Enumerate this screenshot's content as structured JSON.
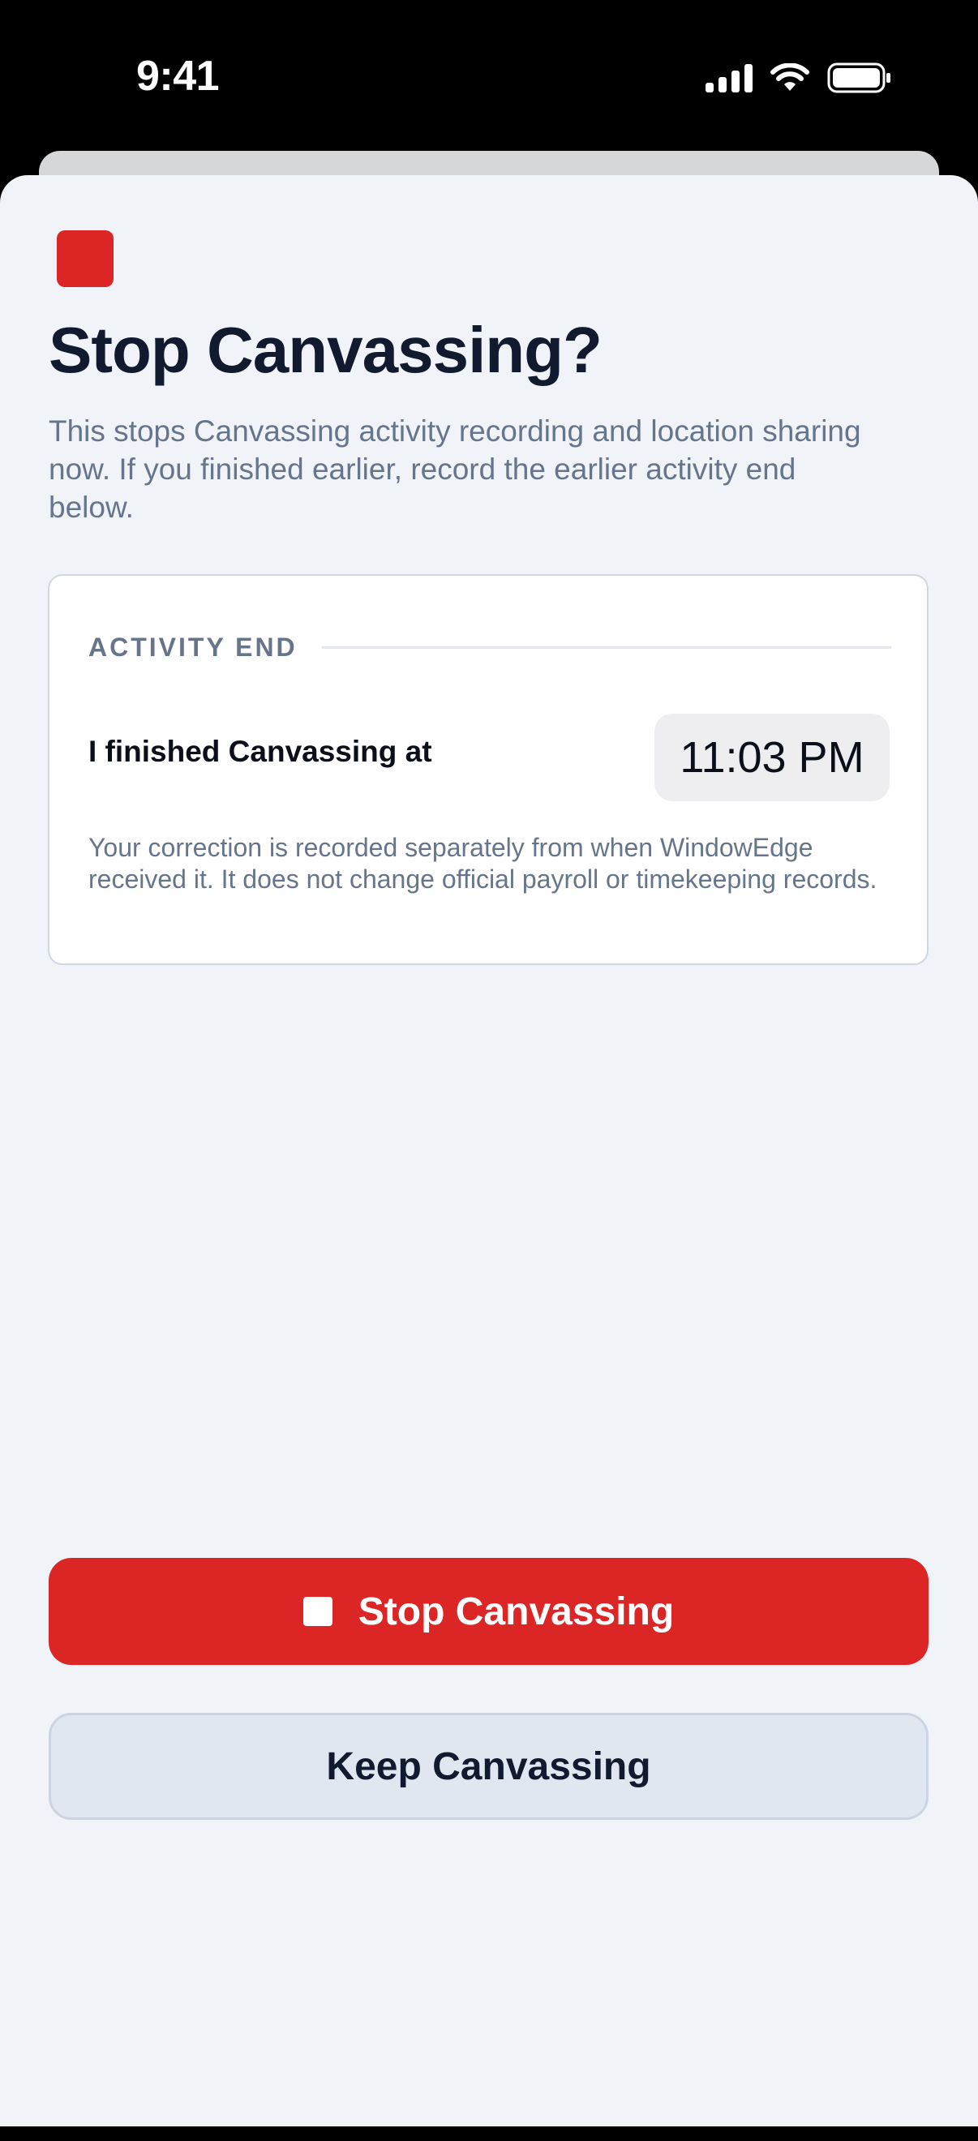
{
  "status_bar": {
    "time": "9:41",
    "icons": [
      "cellular-signal-icon",
      "wifi-icon",
      "battery-icon"
    ]
  },
  "dialog": {
    "icon": "stop-square-icon",
    "title": "Stop Canvassing?",
    "subtitle": "This stops Canvassing activity recording and location sharing now. If you finished earlier, record the earlier activity end below."
  },
  "activity_end": {
    "section_label": "ACTIVITY END",
    "finish_label": "I finished Canvassing at",
    "time_value": "11:03 PM",
    "note": "Your correction is recorded separately from when WindowEdge received it. It does not change official payroll or timekeeping records."
  },
  "actions": {
    "stop_label": "Stop Canvassing",
    "keep_label": "Keep Canvassing"
  },
  "colors": {
    "accent_red": "#dc2626",
    "sheet_background": "#f0f3f8",
    "title_text": "#111a2e",
    "muted_text": "#66758b"
  }
}
